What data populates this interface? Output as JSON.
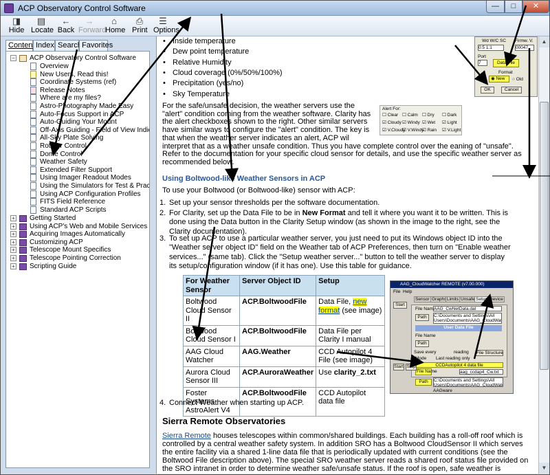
{
  "window": {
    "title": "ACP Observatory Control Software"
  },
  "toolbar": {
    "buttons": [
      {
        "label": "Hide",
        "icon": "hide-icon"
      },
      {
        "label": "Locate",
        "icon": "locate-icon"
      },
      {
        "label": "Back",
        "icon": "back-icon"
      },
      {
        "label": "Forward",
        "icon": "forward-icon"
      },
      {
        "label": "Home",
        "icon": "home-icon"
      },
      {
        "label": "Print",
        "icon": "print-icon"
      },
      {
        "label": "Options",
        "icon": "options-icon"
      }
    ]
  },
  "left_tabs": [
    "Contents",
    "Index",
    "Search",
    "Favorites"
  ],
  "tree": {
    "root": "ACP Observatory Control Software",
    "children": [
      "Overview",
      "New Users, Read this!",
      "Coordinate Systems (ref)",
      "Release Notes",
      "Where are my files?",
      "Astro-Photography Made Easy",
      "Auto-Focus Support in ACP",
      "Auto-Guiding Your Mount",
      "Off-Axis Guiding - Field of View Indicators",
      "All-Sky Plate Solving",
      "Rotator Control",
      "Dome Control",
      "Weather Safety",
      "Extended Filter Support",
      "Using Imager Readout Modes",
      "Using the Simulators for Test & Practice",
      "Using ACP Configuration Profiles",
      "FITS Field Reference",
      "Standard ACP Scripts"
    ],
    "books": [
      "Getting Started",
      "Using ACP's Web and Mobile Services",
      "Acquiring Images Automatically",
      "Customizing ACP",
      "Telescope Mount Specifics",
      "Telescope Pointing Correction",
      "Scripting Guide"
    ]
  },
  "content": {
    "bullets": [
      "Inside temperature",
      "Dew point temperature",
      "Relative Humidity",
      "Cloud coverage (0%/50%/100%)",
      "Precipitation (yes/no)",
      "Sky Temperature"
    ],
    "para1_lines": [
      "For the safe/unsafe decision, the weather servers use the",
      "\"alert\" condition coming from the weather software. Clarity has",
      "the alert checkboxes shown to the right. Other similar servers",
      "have similar ways to configure the \"alert\" condition. The key is",
      "that when the weather server indicates an alert, ACP wil",
      "interpret that as a weather unsafe condition. Thus you have complete control over the eaning of \"unsafe\".",
      "Refer to the documentation for your specific cloud sensor for details, and use the specific weather server as",
      "recommended below."
    ],
    "section1": "Using Boltwood-like Weather Sensors in ACP",
    "intro": "To use your Boltwood (or Boltwood-like) sensor with ACP:",
    "steps": [
      {
        "n": "1.",
        "lines": [
          "Set up your sensor thresholds per the software documentation."
        ]
      },
      {
        "n": "2.",
        "lines": [
          "For Clarity, set up the Data File to be in New Format and tell it where you want it to be written. This is",
          "done using the Data button in the Clarity Setup window (as shown in the image to the right, see the",
          "Clarity documentation)."
        ]
      },
      {
        "n": "3.",
        "lines": [
          "To set up ACP to use a particular weather server, you just need to put its Windows object ID into the",
          "\"Weather server object ID\" field on the Weather tab of ACP Preferences, then turn on \"Enable weather",
          "services...\" (same tab). Click the \"Setup weather server...\" button to tell the weather server to display",
          "its setup/configuration window (if it has one). Use this table for guidance."
        ]
      }
    ],
    "table": {
      "headers": [
        "For Weather Sensor",
        "Server Object ID",
        "Setup"
      ],
      "rows": [
        {
          "sensor": "Boltwood Cloud Sensor II",
          "obj": "ACP.BoltwoodFile",
          "setup_pre": "Data File, ",
          "setup_link": "new format",
          "setup_post": " (see image)"
        },
        {
          "sensor": "Boltwood Cloud Sensor I",
          "obj": "ACP.BoltwoodFile",
          "setup_pre": "Data File per Clarity I manual",
          "setup_link": "",
          "setup_post": ""
        },
        {
          "sensor": "AAG Cloud Watcher",
          "obj": "AAG.Weather",
          "setup_pre": "CCD Autopilot 4 File (see image)",
          "setup_link": "",
          "setup_post": ""
        },
        {
          "sensor": "Aurora Cloud Sensor III",
          "obj": "ACP.AuroraWeather",
          "setup_pre": "Use clarity_2.txt",
          "setup_link": "",
          "setup_post": ""
        },
        {
          "sensor": "Foster Systems AstroAlert V4",
          "obj": "ACP.BoltwoodFile",
          "setup_pre": "CCD Autopilot data file",
          "setup_link": "",
          "setup_post": ""
        }
      ]
    },
    "step4": {
      "n": "4.",
      "text": "Connect Weather when starting up ACP."
    },
    "section2": "Sierra Remote Observatories",
    "sro_link": "Sierra Remote",
    "sro_lines": [
      " houses telescopes within common/shared buildings. Each building has a roll-off roof which is",
      "controlled by a central weather safety system. In addition SRO has a Boltwood CloudSensor II which serves",
      "the entire facility via a shared 1-line data file that is periodically updated with current conditions (see the",
      "Boltwood File description above). The special SRO weather server reads a shared roof status file provided on",
      "the SRO intranet in order to determine weather safe/unsafe status. If the roof is open, safe weather is"
    ]
  },
  "dlg_clarity": {
    "lbl1": "Wd W/C SC",
    "lbl2": "Firmw. V.",
    "v1": "0:5 1:1",
    "v2": "00047",
    "port": "Port",
    "port_val": "7",
    "data_btn": "Data File",
    "format": "Format",
    "new": "New",
    "old": "Old",
    "ok": "OK",
    "cancel": "Cancel"
  },
  "dlg_alert": {
    "title": "Alert For:",
    "items": [
      "Clear",
      "Calm",
      "Dry",
      "Dark",
      "Cloudy",
      "Windy",
      "Wet",
      "Light",
      "V.Cloudy",
      "V.Windy",
      "Rain",
      "V.Light"
    ]
  },
  "dlg_aag": {
    "title": "AAG_CloudWatcher REMOTE (v7.00.000)",
    "menu": [
      "File",
      "Help"
    ],
    "tabs": [
      "Sensor",
      "Graphs",
      "Limits",
      "Unsafe",
      "Setup",
      "Device"
    ],
    "start": "Start",
    "stop": "Stop",
    "file_name": "File Name",
    "path": "Path",
    "netdata": "AAG_CwNetData.dat",
    "dir1": "C:\\Documents and Settings\\All Users\\Documents\\AAG_CloudWatcher",
    "user_data": "User Data File",
    "save_every": "Save every",
    "reading": "reading",
    "mode": "Mode",
    "last_only": "Last reading only",
    "file_structure": "File Structure",
    "autopilot": "CCDAutopilot 4 data file",
    "ccdap": "aag_ccdap4_Cw.txt",
    "aag": "AAGware"
  },
  "colors": {
    "titlebar": "#9fbbdc",
    "link": "#1a4c8a",
    "section": "#2b5797",
    "table_head": "#c8e0f0",
    "highlight": "#ffff00"
  }
}
